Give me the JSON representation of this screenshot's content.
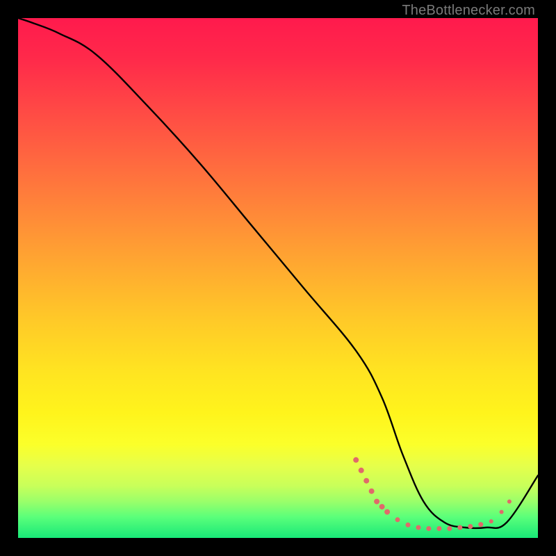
{
  "attribution": "TheBottlenecker.com",
  "colors": {
    "curve": "#000000",
    "dot": "#e06a6a",
    "background": "#000000"
  },
  "chart_data": {
    "type": "line",
    "title": "",
    "xlabel": "",
    "ylabel": "",
    "xlim": [
      0,
      100
    ],
    "ylim": [
      0,
      100
    ],
    "grid": false,
    "series": [
      {
        "name": "bottleneck-curve",
        "x": [
          0,
          3,
          8,
          15,
          25,
          35,
          45,
          55,
          65,
          70,
          74,
          78,
          82,
          86,
          90,
          94,
          100
        ],
        "y": [
          100,
          99,
          97,
          93,
          83,
          72,
          60,
          48,
          36,
          27,
          16,
          7,
          3,
          2,
          2,
          3,
          12
        ]
      }
    ],
    "markers": [
      {
        "x": 65,
        "y": 15,
        "r": 4
      },
      {
        "x": 66,
        "y": 13,
        "r": 4
      },
      {
        "x": 67,
        "y": 11,
        "r": 4
      },
      {
        "x": 68,
        "y": 9,
        "r": 4
      },
      {
        "x": 69,
        "y": 7,
        "r": 4
      },
      {
        "x": 70,
        "y": 6,
        "r": 4
      },
      {
        "x": 71,
        "y": 5,
        "r": 4
      },
      {
        "x": 73,
        "y": 3.5,
        "r": 3.5
      },
      {
        "x": 75,
        "y": 2.5,
        "r": 3.5
      },
      {
        "x": 77,
        "y": 2,
        "r": 3.5
      },
      {
        "x": 79,
        "y": 1.8,
        "r": 3.5
      },
      {
        "x": 81,
        "y": 1.8,
        "r": 3.5
      },
      {
        "x": 83,
        "y": 1.8,
        "r": 3.5
      },
      {
        "x": 85,
        "y": 2,
        "r": 3.5
      },
      {
        "x": 87,
        "y": 2.2,
        "r": 3.5
      },
      {
        "x": 89,
        "y": 2.6,
        "r": 3.5
      },
      {
        "x": 91,
        "y": 3.2,
        "r": 3
      },
      {
        "x": 93,
        "y": 5,
        "r": 3
      },
      {
        "x": 94.5,
        "y": 7,
        "r": 3
      }
    ]
  }
}
